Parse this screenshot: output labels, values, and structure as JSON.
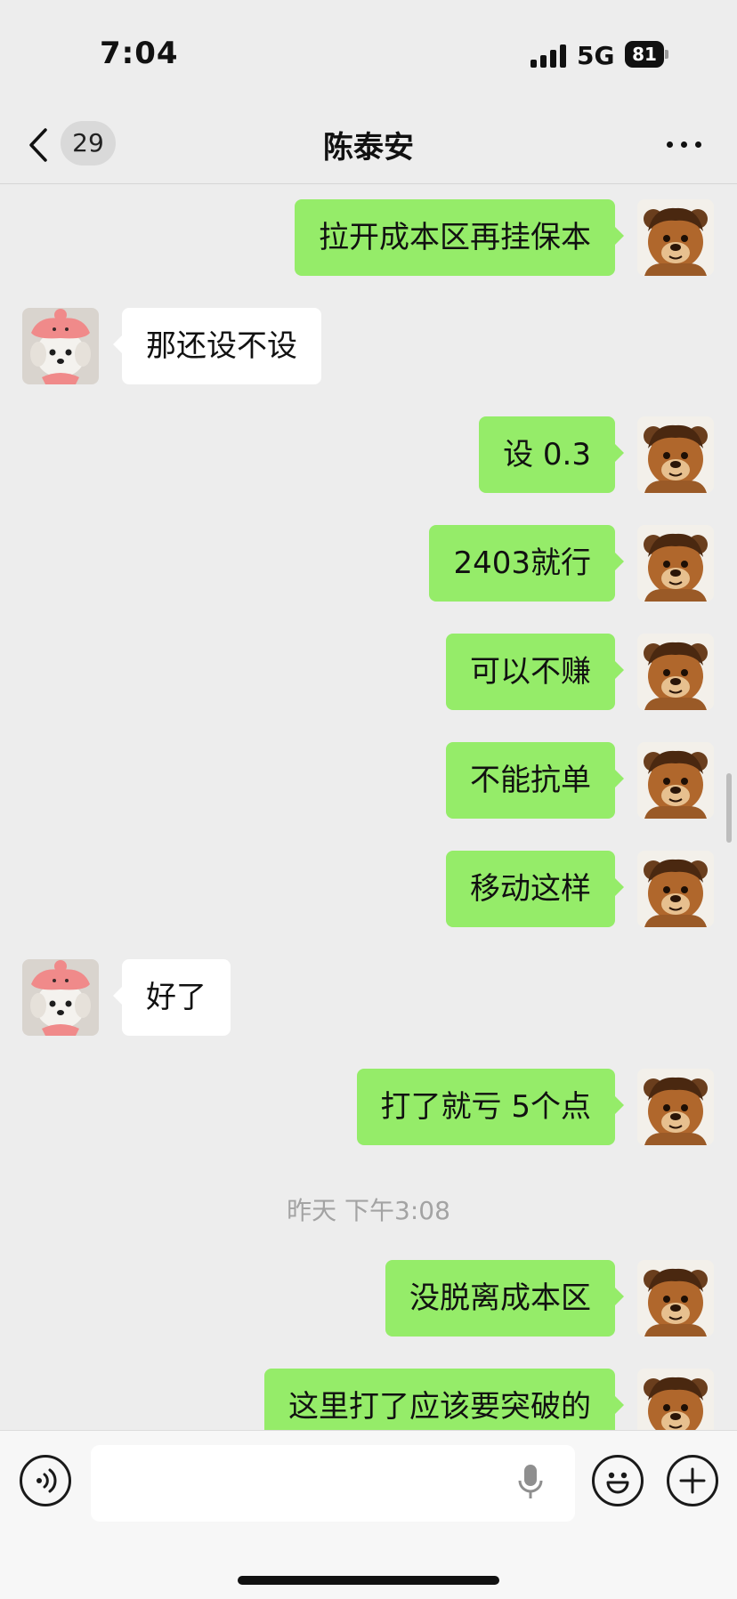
{
  "status_bar": {
    "time": "7:04",
    "network": "5G",
    "battery": "81"
  },
  "header": {
    "back_badge": "29",
    "title": "陈泰安"
  },
  "messages": [
    {
      "side": "out",
      "text": "拉开成本区再挂保本"
    },
    {
      "side": "in",
      "text": "那还设不设"
    },
    {
      "side": "out",
      "text": "设 0.3"
    },
    {
      "side": "out",
      "text": "2403就行"
    },
    {
      "side": "out",
      "text": "可以不赚"
    },
    {
      "side": "out",
      "text": "不能抗单"
    },
    {
      "side": "out",
      "text": "移动这样"
    },
    {
      "side": "in",
      "text": "好了"
    },
    {
      "side": "out",
      "text": "打了就亏 5个点"
    },
    {
      "side": "out",
      "text": "没脱离成本区"
    },
    {
      "side": "out",
      "text": "这里打了应该要突破的"
    }
  ],
  "timestamp": "昨天 下午3:08",
  "input": {
    "value": "",
    "placeholder": ""
  },
  "colors": {
    "outgoing_bubble": "#95ec69",
    "incoming_bubble": "#ffffff",
    "background": "#ededed"
  },
  "icons": [
    "back-chevron-icon",
    "more-icon",
    "voice-icon",
    "mic-icon",
    "emoji-icon",
    "plus-icon"
  ]
}
